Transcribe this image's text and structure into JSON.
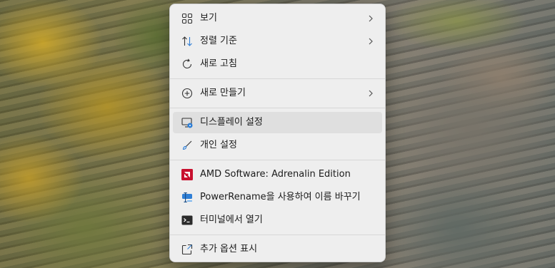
{
  "context_menu": {
    "items": [
      {
        "label": "보기",
        "icon": "grid-view-icon"
      },
      {
        "label": "정렬 기준",
        "icon": "sort-arrows-icon"
      },
      {
        "label": "새로 고침",
        "icon": "refresh-icon"
      },
      {
        "label": "새로 만들기",
        "icon": "plus-circle-icon"
      },
      {
        "label": "디스플레이 설정",
        "icon": "display-settings-icon"
      },
      {
        "label": "개인 설정",
        "icon": "brush-icon"
      },
      {
        "label": "AMD Software: Adrenalin Edition",
        "icon": "amd-logo-icon"
      },
      {
        "label": "PowerRename을 사용하여 이름 바꾸기",
        "icon": "powerrename-icon"
      },
      {
        "label": "터미널에서 열기",
        "icon": "terminal-icon"
      },
      {
        "label": "추가 옵션 표시",
        "icon": "show-more-icon"
      }
    ]
  },
  "colors": {
    "menu_background": "#eeeeee",
    "hover_background": "#dfdfdf",
    "amd_red": "#c8102e",
    "accent_blue": "#2f7fd6"
  }
}
